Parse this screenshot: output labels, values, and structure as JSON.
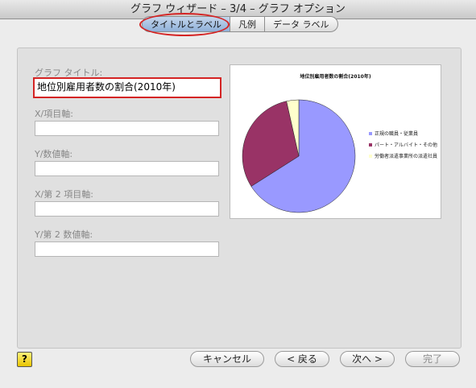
{
  "window": {
    "title": "グラフ ウィザード – 3/4 – グラフ オプション"
  },
  "tabs": [
    {
      "label": "タイトルとラベル"
    },
    {
      "label": "凡例"
    },
    {
      "label": "データ ラベル"
    }
  ],
  "fields": {
    "chart_title": {
      "label": "グラフ タイトル:",
      "value": "地位別雇用者数の割合(2010年)"
    },
    "x_axis": {
      "label": "X/項目軸:",
      "value": ""
    },
    "y_axis": {
      "label": "Y/数値軸:",
      "value": ""
    },
    "x2_axis": {
      "label": "X/第 2 項目軸:",
      "value": ""
    },
    "y2_axis": {
      "label": "Y/第 2 数値軸:",
      "value": ""
    }
  },
  "preview": {
    "title": "地位別雇用者数の割合(2010年)"
  },
  "chart_data": {
    "type": "pie",
    "title": "地位別雇用者数の割合(2010年)",
    "legend_position": "right",
    "slices": [
      {
        "label": "正規の職員・従業員",
        "value": 66,
        "color": "#9999ff"
      },
      {
        "label": "パート・アルバイト・その他",
        "value": 30.5,
        "color": "#993366"
      },
      {
        "label": "労働者派遣事業所の派遣社員",
        "value": 3.5,
        "color": "#ffffcc"
      }
    ]
  },
  "buttons": {
    "help": "?",
    "cancel": "キャンセル",
    "back": "< 戻る",
    "next": "次へ >",
    "finish": "完了"
  }
}
